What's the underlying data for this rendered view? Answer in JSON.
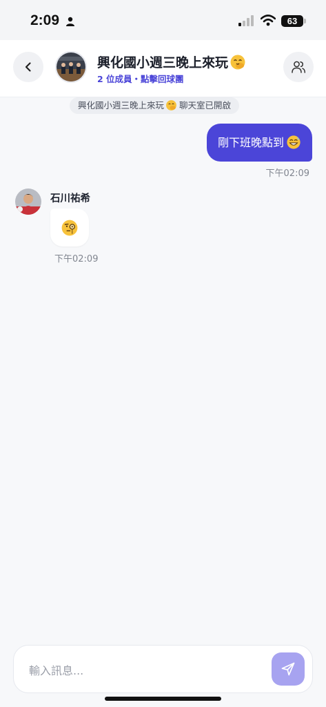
{
  "status_bar": {
    "time": "2:09",
    "battery": "63"
  },
  "header": {
    "title": "興化國小週三晚上來玩",
    "title_emoji": "face-with-hand-over-mouth-emoji",
    "subtitle": "2 位成員・點擊回球團",
    "back_icon": "chevron-left-icon",
    "members_icon": "users-icon"
  },
  "system_message": {
    "text_part1": "興化國小週三晚上來玩",
    "text_part2": "聊天室已開啟"
  },
  "messages": [
    {
      "direction": "out",
      "text": "剛下班晚點到",
      "emoji": "grinning-sweat-emoji",
      "time": "下午02:09"
    },
    {
      "direction": "in",
      "sender": "石川祐希",
      "emoji": "face-with-monocle-emoji",
      "time": "下午02:09"
    }
  ],
  "composer": {
    "placeholder": "輸入訊息...",
    "send_icon": "send-icon"
  },
  "colors": {
    "accent": "#4b45d8",
    "send_button": "#a7a3f0",
    "background": "#f7f8fa",
    "muted_text": "#80858f"
  }
}
